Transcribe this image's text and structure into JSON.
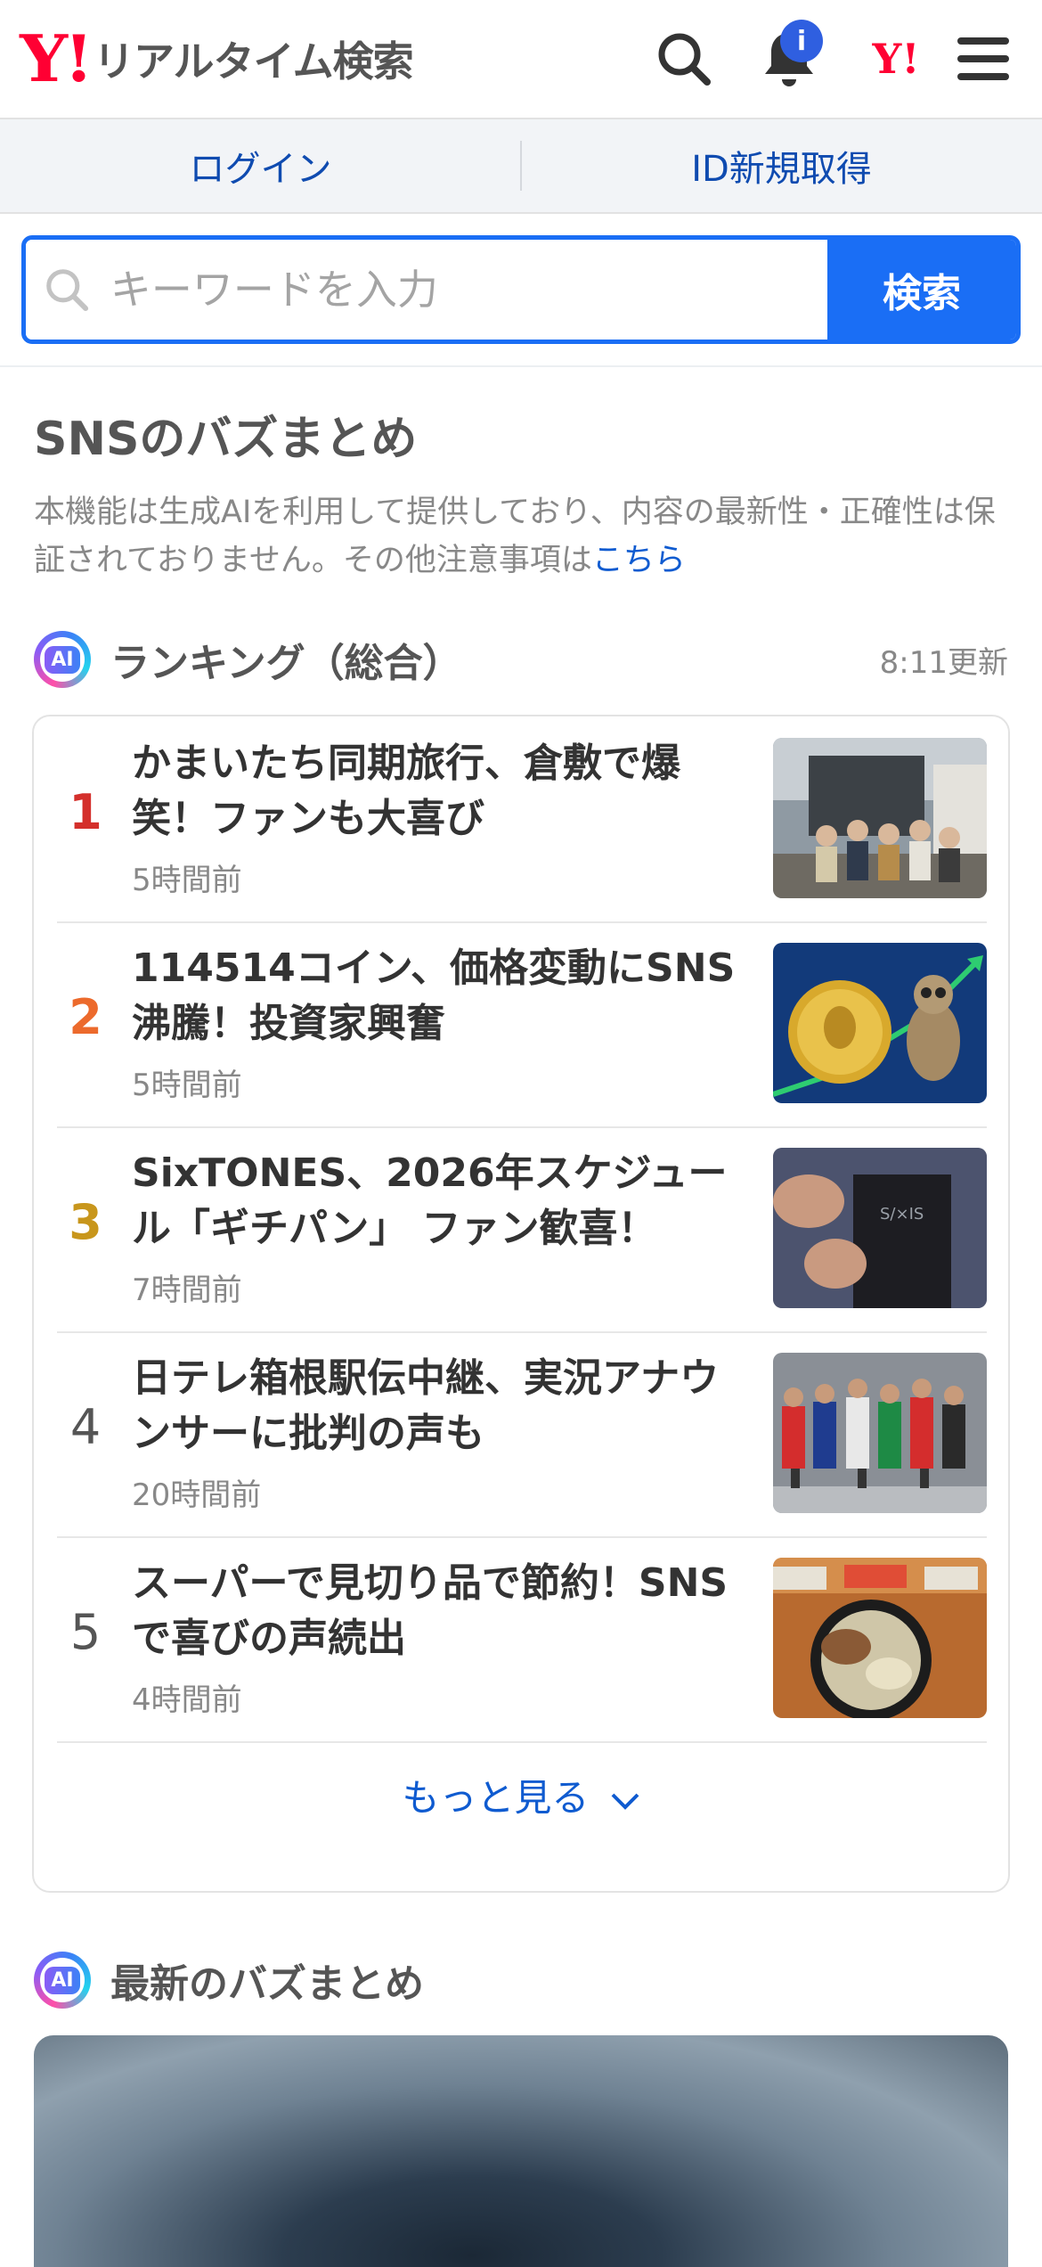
{
  "header": {
    "logo_mark": "Y!",
    "logo_text": "リアルタイム検索",
    "notification_badge": "i",
    "yahoo_mini_logo": "Y!",
    "icons": [
      "search-icon",
      "bell-icon",
      "yahoo-logo-icon",
      "menu-icon"
    ]
  },
  "login_bar": {
    "login": "ログイン",
    "signup": "ID新規取得"
  },
  "search": {
    "placeholder": "キーワードを入力",
    "button": "検索"
  },
  "section": {
    "title": "SNSのバズまとめ",
    "disclaimer": "本機能は生成AIを利用して提供しており、内容の最新性・正確性は保証されておりません。その他注意事項は",
    "disclaimer_link": "こちら"
  },
  "ranking": {
    "ai_label": "AI",
    "title": "ランキング（総合）",
    "updated": "8:11更新",
    "items": [
      {
        "rank": "1",
        "title": "かまいたち同期旅行、倉敷で爆笑！ファンも大喜び",
        "time": "5時間前",
        "rank_color": "#d4302c"
      },
      {
        "rank": "2",
        "title": "114514コイン、価格変動にSNS沸騰！投資家興奮",
        "time": "5時間前",
        "rank_color": "#ec6a2c"
      },
      {
        "rank": "3",
        "title": "SixTONES、2026年スケジュール「ギチパン」 ファン歓喜！",
        "time": "7時間前",
        "rank_color": "#c8961c"
      },
      {
        "rank": "4",
        "title": "日テレ箱根駅伝中継、実況アナウンサーに批判の声も",
        "time": "20時間前",
        "rank_color": "#555555"
      },
      {
        "rank": "5",
        "title": "スーパーで見切り品で節約！SNSで喜びの声続出",
        "time": "4時間前",
        "rank_color": "#555555"
      }
    ],
    "more": "もっと見る"
  },
  "latest": {
    "ai_label": "AI",
    "title": "最新のバズまとめ"
  },
  "colors": {
    "accent": "#1a6ef5",
    "link": "#0f5bd0",
    "brand": "#ff0033"
  }
}
